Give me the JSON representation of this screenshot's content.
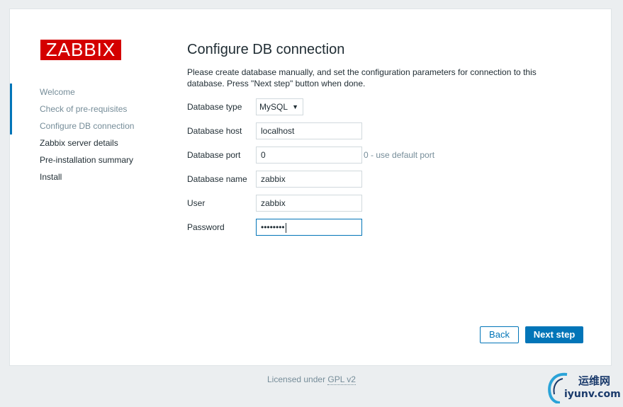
{
  "logo": {
    "text": "ZABBIX",
    "color": "#d40000"
  },
  "steps": [
    {
      "label": "Welcome",
      "state": "done"
    },
    {
      "label": "Check of pre-requisites",
      "state": "done"
    },
    {
      "label": "Configure DB connection",
      "state": "current"
    },
    {
      "label": "Zabbix server details",
      "state": "pending"
    },
    {
      "label": "Pre-installation summary",
      "state": "pending"
    },
    {
      "label": "Install",
      "state": "pending"
    }
  ],
  "page": {
    "title": "Configure DB connection",
    "description": "Please create database manually, and set the configuration parameters for connection to this database. Press \"Next step\" button when done."
  },
  "form": {
    "db_type": {
      "label": "Database type",
      "value": "MySQL"
    },
    "db_host": {
      "label": "Database host",
      "value": "localhost"
    },
    "db_port": {
      "label": "Database port",
      "value": "0",
      "hint": "0 - use default port"
    },
    "db_name": {
      "label": "Database name",
      "value": "zabbix"
    },
    "user": {
      "label": "User",
      "value": "zabbix"
    },
    "password": {
      "label": "Password",
      "value": "••••••••"
    }
  },
  "buttons": {
    "back": "Back",
    "next": "Next step"
  },
  "footer": {
    "prefix": "Licensed under",
    "link": "GPL v2"
  },
  "watermark": {
    "cn": "运维网",
    "en": "iyunv.com"
  },
  "colors": {
    "accent": "#0275b8",
    "brand": "#d40000",
    "muted": "#768d99"
  }
}
